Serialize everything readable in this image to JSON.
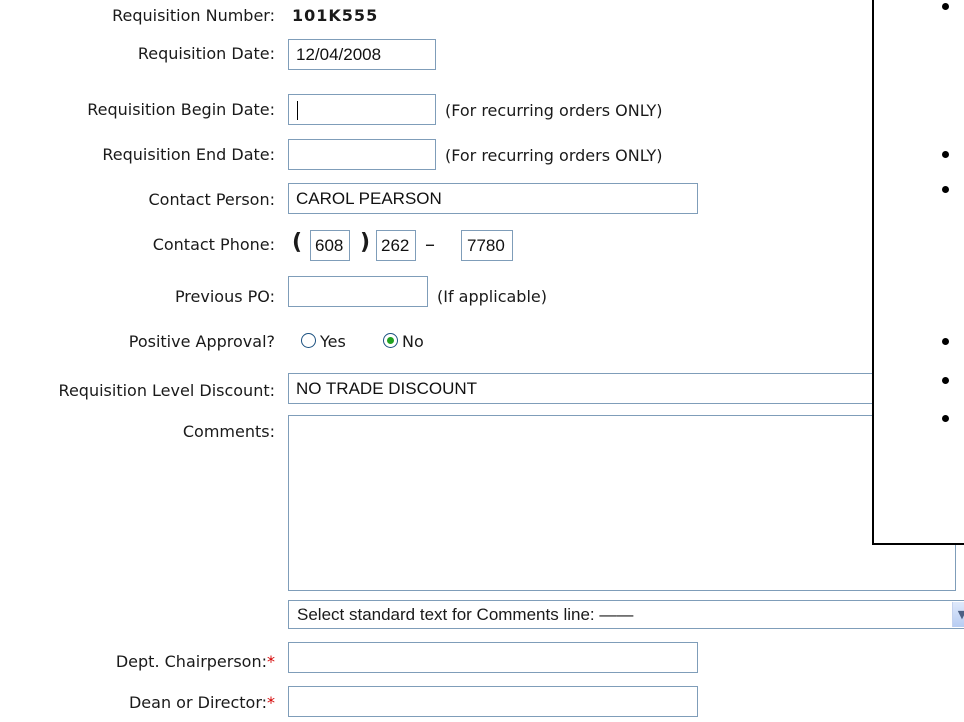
{
  "form": {
    "requisition_number": {
      "label": "Requisition Number:",
      "value": "101K555"
    },
    "requisition_date": {
      "label": "Requisition Date:",
      "value": "12/04/2008"
    },
    "begin_date": {
      "label": "Requisition Begin Date:",
      "value": "",
      "note": "(For recurring orders ONLY)"
    },
    "end_date": {
      "label": "Requisition End Date:",
      "value": "",
      "note": "(For recurring orders ONLY)"
    },
    "contact_person": {
      "label": "Contact Person:",
      "value": "CAROL PEARSON"
    },
    "contact_phone": {
      "label": "Contact Phone:",
      "open_paren": "(",
      "area": "608",
      "close_paren": ")",
      "prefix": "262",
      "dash": "–",
      "line": "7780"
    },
    "previous_po": {
      "label": "Previous PO:",
      "value": "",
      "note": "(If applicable)"
    },
    "positive_approval": {
      "label": "Positive Approval?",
      "yes_label": "Yes",
      "no_label": "No",
      "selected": "No"
    },
    "discount": {
      "label": "Requisition Level Discount:",
      "value": "NO TRADE DISCOUNT"
    },
    "comments": {
      "label": "Comments:",
      "value": ""
    },
    "standard_text": {
      "selected": "Select standard text for Comments line: ——"
    },
    "dept_chair": {
      "label": "Dept. Chairperson:",
      "required_mark": "*",
      "value": ""
    },
    "dean": {
      "label": "Dean or Director:",
      "required_mark": "*",
      "value": ""
    }
  },
  "colors": {
    "required": "#d40000",
    "field_border": "#7f9db9",
    "radio_selected": "#21a121"
  }
}
